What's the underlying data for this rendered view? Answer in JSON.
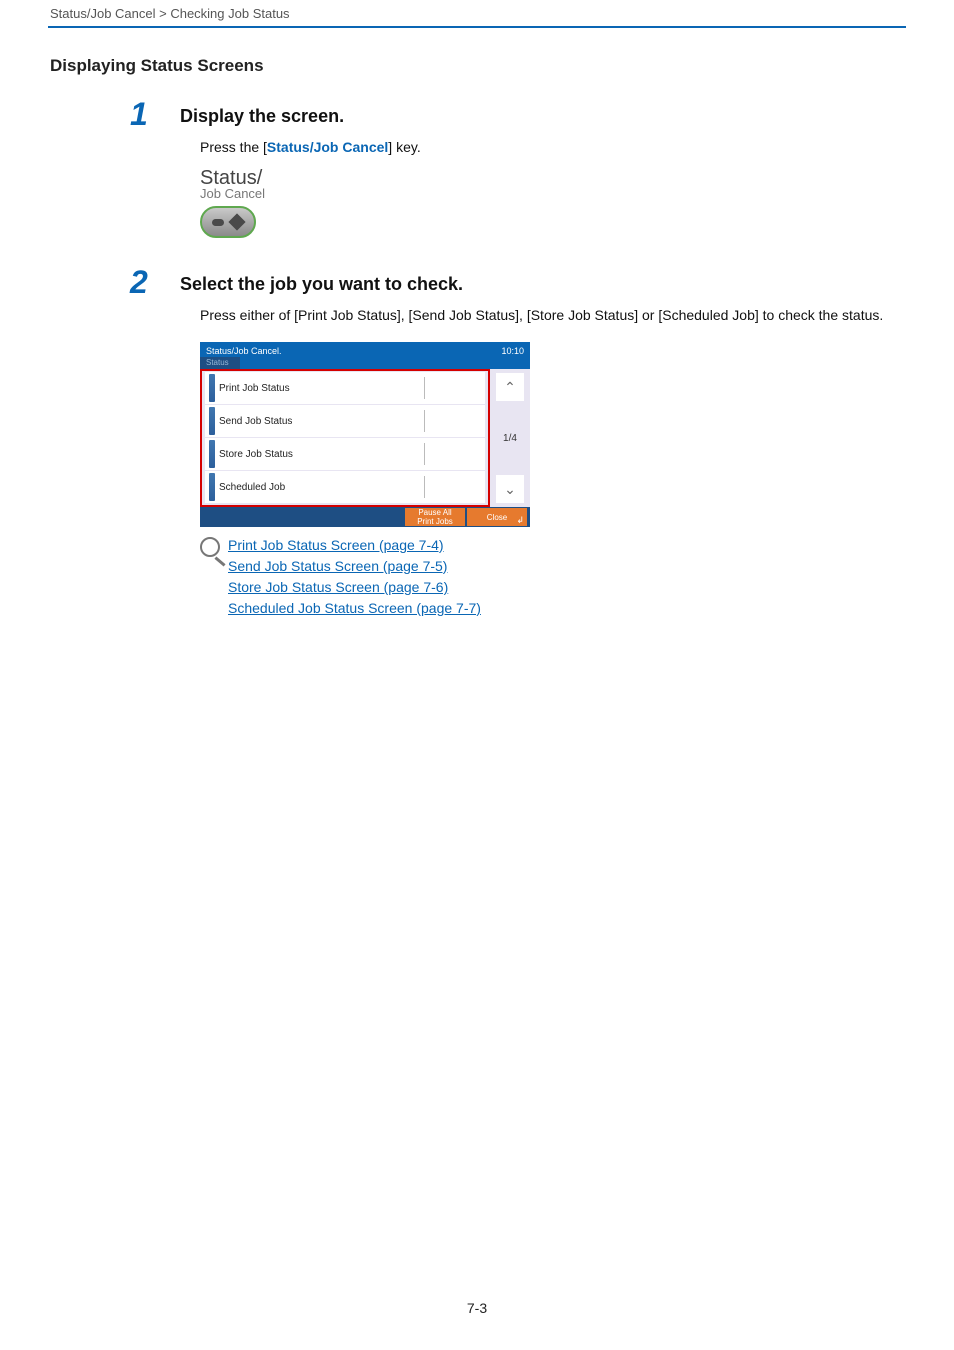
{
  "breadcrumb": "Status/Job Cancel > Checking Job Status",
  "section_title": "Displaying Status Screens",
  "steps": [
    {
      "num": "1",
      "heading": "Display the screen.",
      "body_pre": "Press the [",
      "body_key": "Status/Job Cancel",
      "body_post": "] key."
    },
    {
      "num": "2",
      "heading": "Select the job you want to check.",
      "body_full": "Press either of [Print Job Status], [Send Job Status], [Store Job Status] or [Scheduled Job] to check the status."
    }
  ],
  "hw_label": {
    "line1": "Status/",
    "line2": "Job Cancel"
  },
  "panel": {
    "title": "Status/Job Cancel.",
    "time": "10:10",
    "tab": "Status",
    "rows": [
      "Print Job Status",
      "Send Job Status",
      "Store Job Status",
      "Scheduled Job"
    ],
    "page_indicator": "1/4",
    "footer": {
      "pause_line1": "Pause All",
      "pause_line2": "Print Jobs",
      "close": "Close"
    }
  },
  "refs": [
    "Print Job Status Screen (page 7-4)",
    "Send Job Status Screen (page 7-5)",
    "Store Job Status Screen (page 7-6)",
    "Scheduled Job Status Screen (page 7-7)"
  ],
  "page_number": "7-3"
}
